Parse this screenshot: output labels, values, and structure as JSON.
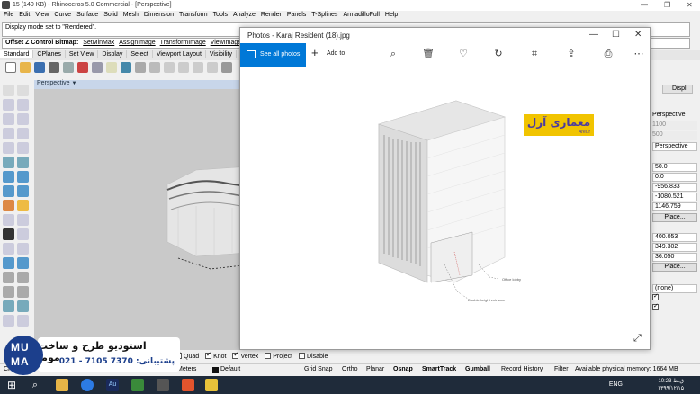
{
  "rhino": {
    "title": "15 (140 KB) - Rhinoceros 5.0 Commercial - [Perspective]",
    "menu": [
      "File",
      "Edit",
      "View",
      "Curve",
      "Surface",
      "Solid",
      "Mesh",
      "Dimension",
      "Transform",
      "Tools",
      "Analyze",
      "Render",
      "Panels",
      "T-Splines",
      "ArmadilloFull",
      "Help"
    ],
    "command_history": "Display mode set to \"Rendered\".",
    "command_prompt": "Offset Z Control Bitmap:",
    "command_options": [
      "SetMinMax",
      "AssignImage",
      "TransformImage",
      "ViewImage",
      "Tr"
    ],
    "toolbar_tabs": [
      "Standard",
      "CPlanes",
      "Set View",
      "Display",
      "Select",
      "Viewport Layout",
      "Visibility",
      "Tr"
    ],
    "viewport_label": "Perspective",
    "osnaps": [
      {
        "label": "Quad",
        "checked": true
      },
      {
        "label": "Knot",
        "checked": true
      },
      {
        "label": "Vertex",
        "checked": true
      },
      {
        "label": "Project",
        "checked": false
      },
      {
        "label": "Disable",
        "checked": false
      }
    ],
    "status": {
      "cplane": "CPla",
      "units": "Meters",
      "layer": "Default",
      "grid_snap": "Grid Snap",
      "ortho": "Ortho",
      "planar": "Planar",
      "osnap": "Osnap",
      "smarttrack": "SmartTrack",
      "gumball": "Gumball",
      "record_history": "Record History",
      "filter": "Filter",
      "memory": "Available physical memory: 1664 MB"
    },
    "properties": {
      "tab_label": "Displ",
      "projection": "Perspective",
      "val_1100": "1100",
      "val_500": "500",
      "projection_select": "Perspective",
      "lens": "50.0",
      "rotation": "0.0",
      "cam_x": "-956.833",
      "cam_y": "-1080.521",
      "cam_z": "1146.759",
      "place_1": "Place...",
      "target_x": "400.053",
      "target_y": "349.302",
      "target_z": "36.050",
      "place_2": "Place...",
      "wallpaper": "(none)"
    }
  },
  "photos": {
    "title": "Photos - Karaj Resident (18).jpg",
    "see_all": "See all photos",
    "add_to": "Add to",
    "annotation_1": "Office lobby",
    "annotation_2": "Double height entrance",
    "logo_arabic": "معماری آرل",
    "logo_sub": "Arel.ir"
  },
  "watermark": {
    "logo_top": "MU",
    "logo_bottom": "MA",
    "studio_name": "استودیو طرح و ساخت موما",
    "support_phone": "پشتیبانی: 7370 7105 - 021"
  },
  "taskbar": {
    "lang": "ENG",
    "time": "ق.ظ 10:23",
    "date": "۱۳۹۹/۱۲/۱۵"
  },
  "colors": {
    "accent": "#0078d7",
    "taskbar": "#1f2b3a",
    "logo_yellow": "#f1c400",
    "muma_blue": "#1c3f8c"
  }
}
